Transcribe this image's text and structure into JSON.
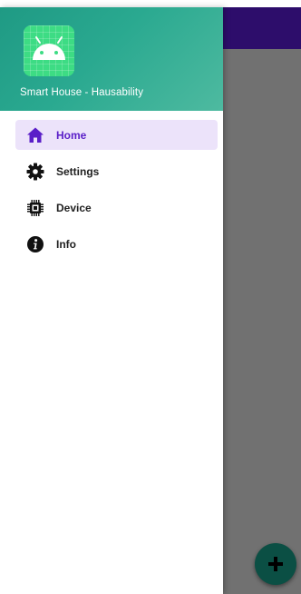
{
  "drawer": {
    "app_title": "Smart House - Hausability",
    "items": [
      {
        "label": "Home",
        "icon": "home-icon",
        "active": true
      },
      {
        "label": "Settings",
        "icon": "gear-icon",
        "active": false
      },
      {
        "label": "Device",
        "icon": "chip-icon",
        "active": false
      },
      {
        "label": "Info",
        "icon": "info-icon",
        "active": false
      }
    ]
  },
  "fab": {
    "icon": "plus-icon"
  },
  "colors": {
    "toolbar": "#2d0d6b",
    "header_gradient_start": "#1f9a84",
    "header_gradient_end": "#4ebaa0",
    "active_item_bg": "#ece3fa",
    "active_accent": "#5a1ec8",
    "fab": "#0b4f44"
  }
}
